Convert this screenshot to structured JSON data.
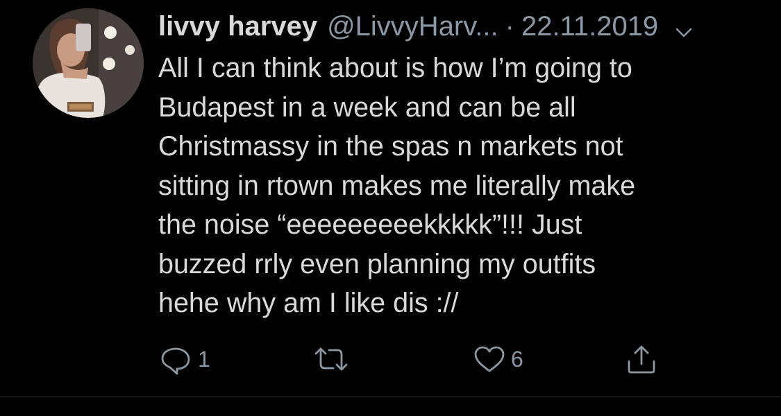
{
  "tweet": {
    "display_name": "livvy harvey",
    "handle": "@LivvyHarv...",
    "separator": "·",
    "date": "22.11.2019",
    "text": "All I can think about is how I’m going to\nBudapest in a week and can be all\nChristmassy in the spas n markets not\nsitting in rtown makes me literally make\nthe noise “eeeeeeeeekkkkk”!!! Just\nbuzzed rrly even planning my outfits\nhehe why am I like dis ://",
    "actions": {
      "reply_count": "1",
      "retweet_count": "",
      "like_count": "6"
    }
  },
  "icons": {
    "menu": "chevron-down-icon",
    "reply": "reply-icon",
    "retweet": "retweet-icon",
    "like": "heart-icon",
    "share": "share-icon"
  },
  "colors": {
    "background": "#000000",
    "text": "#d9d9d9",
    "secondary": "#8b98a5",
    "divider": "#2f3336"
  }
}
